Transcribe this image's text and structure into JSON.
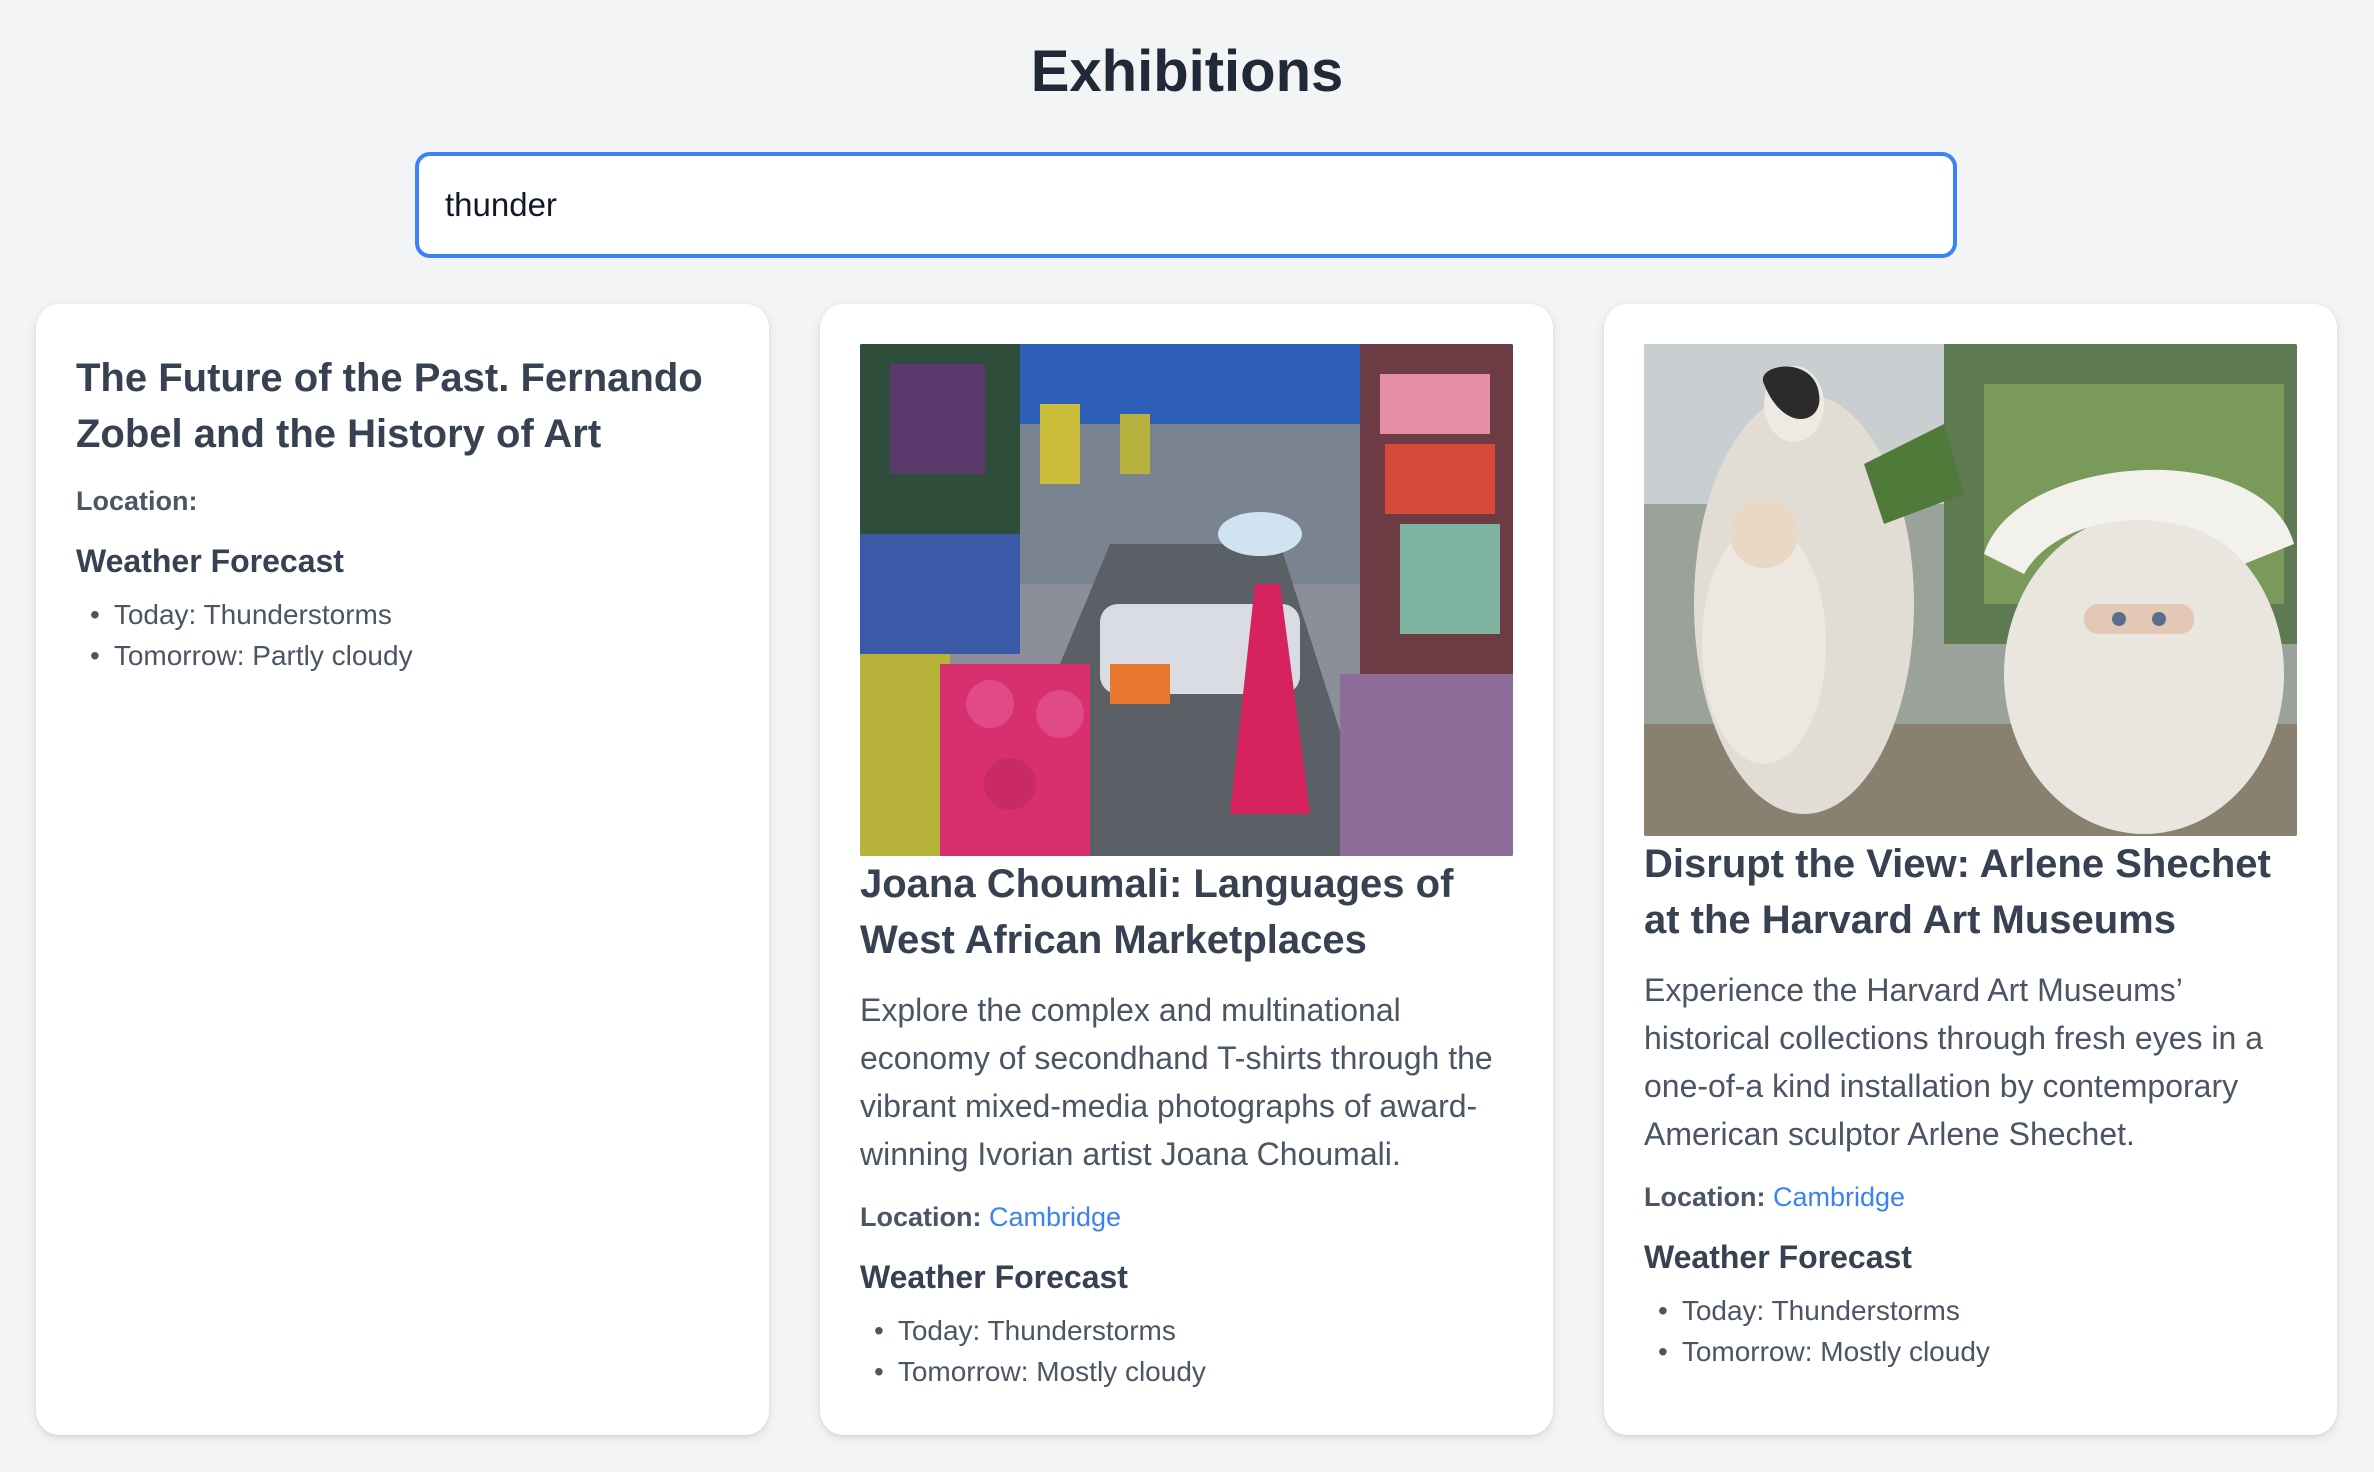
{
  "page": {
    "title": "Exhibitions"
  },
  "search": {
    "value": "thunder"
  },
  "colors": {
    "accent": "#3b82f6",
    "background": "#f3f4f6",
    "card": "#ffffff",
    "heading": "#374151",
    "body_text": "#4b5563"
  },
  "cards": [
    {
      "title": "The Future of the Past. Fernando Zobel and the History of Art",
      "location_label": "Location:",
      "location_value": "",
      "weather_title": "Weather Forecast",
      "forecast": [
        "Today: Thunderstorms",
        "Tomorrow: Partly cloudy"
      ]
    },
    {
      "image_icon": "market-collage-photo",
      "title": "Joana Choumali: Languages of West African Marketplaces",
      "description": "Explore the complex and multinational economy of secondhand T-shirts through the vibrant mixed-media photographs of award-winning Ivorian artist Joana Choumali.",
      "location_label": "Location:",
      "location_value": "Cambridge",
      "weather_title": "Weather Forecast",
      "forecast": [
        "Today: Thunderstorms",
        "Tomorrow: Mostly cloudy"
      ]
    },
    {
      "image_icon": "porcelain-sculpture-photo",
      "title": "Disrupt the View: Arlene Shechet at the Harvard Art Museums",
      "description": "Experience the Harvard Art Museums’ historical collections through fresh eyes in a one-of-a kind installation by contemporary American sculptor Arlene Shechet.",
      "location_label": "Location:",
      "location_value": "Cambridge",
      "weather_title": "Weather Forecast",
      "forecast": [
        "Today: Thunderstorms",
        "Tomorrow: Mostly cloudy"
      ]
    }
  ]
}
